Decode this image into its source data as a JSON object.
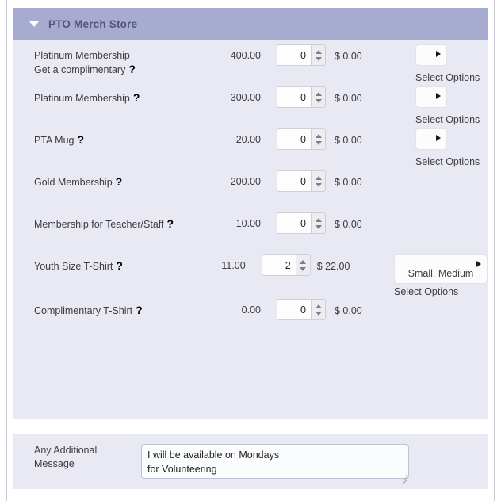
{
  "store": {
    "title": "PTO Merch Store",
    "collapse_icon": "triangle-down-icon",
    "help_icon": "question-mark-icon",
    "select_options_caption": "Select Options",
    "items": [
      {
        "name": "Platinum Membership Get a complimentary",
        "name_line1": "Platinum Membership",
        "name_line2": "Get a complimentary",
        "price": "400.00",
        "qty": "0",
        "subtotal": "$ 0.00",
        "has_options": true,
        "options_value": "",
        "options_caption": "Select Options"
      },
      {
        "name": "Platinum Membership",
        "name_line1": "Platinum Membership",
        "name_line2": "",
        "price": "300.00",
        "qty": "0",
        "subtotal": "$ 0.00",
        "has_options": true,
        "options_value": "",
        "options_caption": "Select Options"
      },
      {
        "name": "PTA Mug",
        "name_line1": "PTA Mug",
        "name_line2": "",
        "price": "20.00",
        "qty": "0",
        "subtotal": "$ 0.00",
        "has_options": true,
        "options_value": "",
        "options_caption": "Select Options"
      },
      {
        "name": "Gold Membership",
        "name_line1": "Gold Membership",
        "name_line2": "",
        "price": "200.00",
        "qty": "0",
        "subtotal": "$ 0.00",
        "has_options": false,
        "options_value": "",
        "options_caption": ""
      },
      {
        "name": "Membership for Teacher/Staff",
        "name_line1": "Membership for Teacher/Staff",
        "name_line2": "",
        "price": "10.00",
        "qty": "0",
        "subtotal": "$ 0.00",
        "has_options": false,
        "options_value": "",
        "options_caption": ""
      },
      {
        "name": "Youth Size T-Shirt",
        "name_line1": "Youth Size T-Shirt",
        "name_line2": "",
        "price": "11.00",
        "qty": "2",
        "subtotal": "$ 22.00",
        "has_options": true,
        "options_value": "Small, Medium",
        "options_caption": "Select Options"
      },
      {
        "name": "Complimentary T-Shirt",
        "name_line1": "Complimentary T-Shirt",
        "name_line2": "",
        "price": "0.00",
        "qty": "0",
        "subtotal": "$ 0.00",
        "has_options": false,
        "options_value": "",
        "options_caption": ""
      }
    ]
  },
  "message": {
    "label_line1": "Any Additional",
    "label_line2": "Message",
    "value": "I will be available on Mondays\nfor Volunteering",
    "placeholder": ""
  },
  "colors": {
    "header_bar": "#a8abd0",
    "panel_bg": "#e9e9f4",
    "header_text": "#555574",
    "body_text": "#3c3c3c",
    "page_bg": "#ffffff"
  }
}
